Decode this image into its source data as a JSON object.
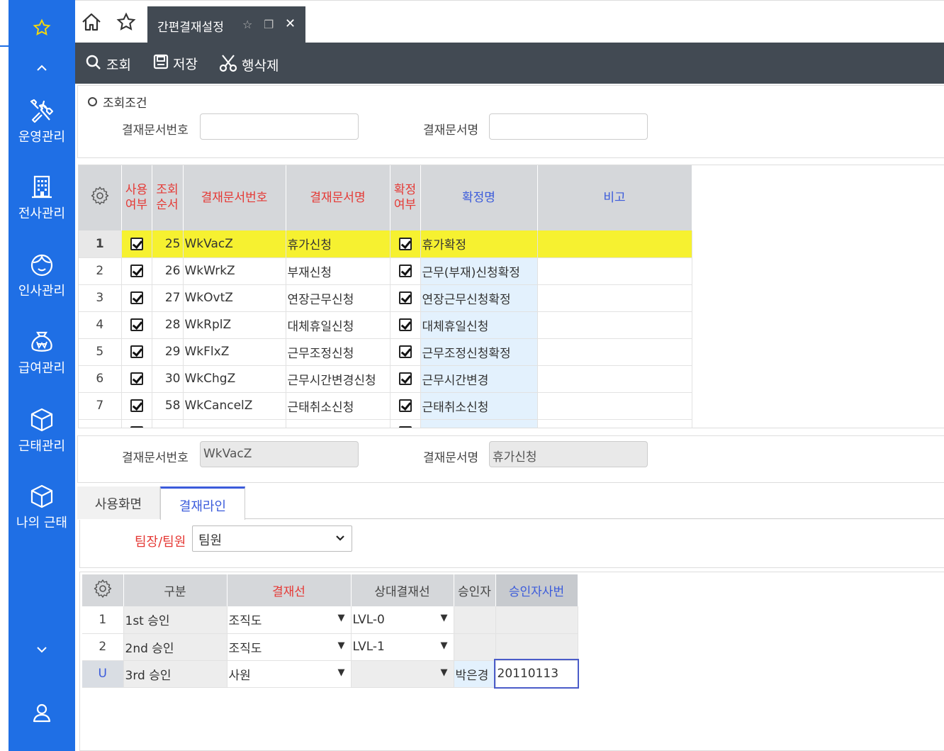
{
  "sidebar": {
    "items": [
      {
        "label": "운영관리",
        "icon": "tools-icon"
      },
      {
        "label": "전사관리",
        "icon": "building-icon"
      },
      {
        "label": "인사관리",
        "icon": "face-icon"
      },
      {
        "label": "급여관리",
        "icon": "money-bag-icon"
      },
      {
        "label": "근태관리",
        "icon": "cube-icon"
      },
      {
        "label": "나의 근태",
        "icon": "cube-icon"
      }
    ],
    "accent": "#1f6fe5"
  },
  "tabbar": {
    "active_tab": "간편결재설정"
  },
  "toolbar": {
    "search_label": "조회",
    "save_label": "저장",
    "delete_row_label": "행삭제"
  },
  "search": {
    "section_title": "조회조건",
    "doc_no_label": "결재문서번호",
    "doc_no_value": "",
    "doc_name_label": "결재문서명",
    "doc_name_value": ""
  },
  "grid1": {
    "headers": {
      "use_yn": "사용\n여부",
      "order": "조회\n순서",
      "doc_no": "결재문서번호",
      "doc_name": "결재문서명",
      "confirm_yn": "확정\n여부",
      "confirm_name": "확정명",
      "remark": "비고"
    },
    "rows": [
      {
        "rn": "1",
        "use": true,
        "order": "25",
        "doc_no": "WkVacZ",
        "doc_name": "휴가신청",
        "confirm": true,
        "confirm_name": "휴가확정",
        "remark": ""
      },
      {
        "rn": "2",
        "use": true,
        "order": "26",
        "doc_no": "WkWrkZ",
        "doc_name": "부재신청",
        "confirm": true,
        "confirm_name": "근무(부재)신청확정",
        "remark": ""
      },
      {
        "rn": "3",
        "use": true,
        "order": "27",
        "doc_no": "WkOvtZ",
        "doc_name": "연장근무신청",
        "confirm": true,
        "confirm_name": "연장근무신청확정",
        "remark": ""
      },
      {
        "rn": "4",
        "use": true,
        "order": "28",
        "doc_no": "WkRplZ",
        "doc_name": "대체휴일신청",
        "confirm": true,
        "confirm_name": "대체휴일신청",
        "remark": ""
      },
      {
        "rn": "5",
        "use": true,
        "order": "29",
        "doc_no": "WkFlxZ",
        "doc_name": "근무조정신청",
        "confirm": true,
        "confirm_name": "근무조정신청확정",
        "remark": ""
      },
      {
        "rn": "6",
        "use": true,
        "order": "30",
        "doc_no": "WkChgZ",
        "doc_name": "근무시간변경신청",
        "confirm": true,
        "confirm_name": "근무시간변경",
        "remark": ""
      },
      {
        "rn": "7",
        "use": true,
        "order": "58",
        "doc_no": "WkCancelZ",
        "doc_name": "근태취소신청",
        "confirm": true,
        "confirm_name": "근태취소신청",
        "remark": ""
      }
    ]
  },
  "detail": {
    "doc_no_label": "결재문서번호",
    "doc_no_value": "WkVacZ",
    "doc_name_label": "결재문서명",
    "doc_name_value": "휴가신청"
  },
  "tabs": {
    "tab1": "사용화면",
    "tab2": "결재라인"
  },
  "role": {
    "label": "팀장/팀원",
    "selected": "팀원"
  },
  "grid2": {
    "headers": {
      "category": "구분",
      "line": "결재선",
      "relative_line": "상대결재선",
      "approver": "승인자",
      "approver_id": "승인자사번"
    },
    "rows": [
      {
        "rn": "1",
        "category": "1st 승인",
        "line": "조직도",
        "relative_line": "LVL-0",
        "approver": "",
        "approver_id": ""
      },
      {
        "rn": "2",
        "category": "2nd 승인",
        "line": "조직도",
        "relative_line": "LVL-1",
        "approver": "",
        "approver_id": ""
      },
      {
        "rn": "U",
        "category": "3rd 승인",
        "line": "사원",
        "relative_line": "",
        "approver": "박은경",
        "approver_id": "20110113"
      }
    ]
  }
}
